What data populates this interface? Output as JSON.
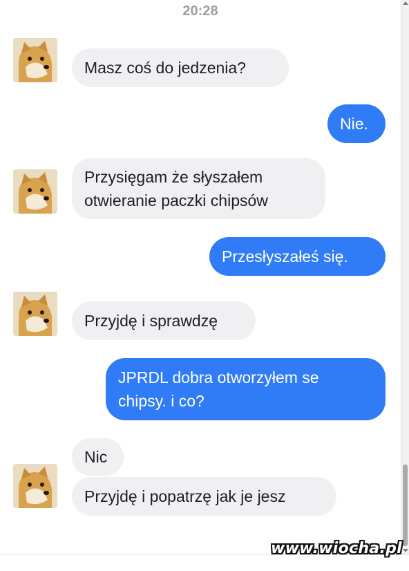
{
  "chat": {
    "timestamp": "20:28",
    "messages": [
      {
        "from": "contact",
        "lines": [
          "Masz coś do jedzenia?"
        ]
      },
      {
        "from": "me",
        "lines": [
          "Nie."
        ]
      },
      {
        "from": "contact",
        "lines": [
          "Przysięgam że słyszałem",
          "otwieranie paczki chipsów"
        ]
      },
      {
        "from": "me",
        "lines": [
          "Przesłyszałeś się."
        ]
      },
      {
        "from": "contact",
        "lines": [
          "Przyjdę i sprawdzę"
        ]
      },
      {
        "from": "me",
        "lines": [
          "JPRDL dobra otworzyłem se",
          "chipsy. i co?"
        ]
      },
      {
        "from": "contact",
        "lines": [
          "Nic"
        ]
      },
      {
        "from": "contact",
        "lines": [
          "Przyjdę i popatrzę jak je jesz"
        ]
      }
    ]
  },
  "avatar": {
    "icon": "doge-avatar-icon"
  },
  "colors": {
    "outgoing_bubble": "#2f7cf6",
    "incoming_bubble": "#f0f0f3",
    "timestamp": "#9a9ea5"
  },
  "watermark": "www.wiocha.pl"
}
